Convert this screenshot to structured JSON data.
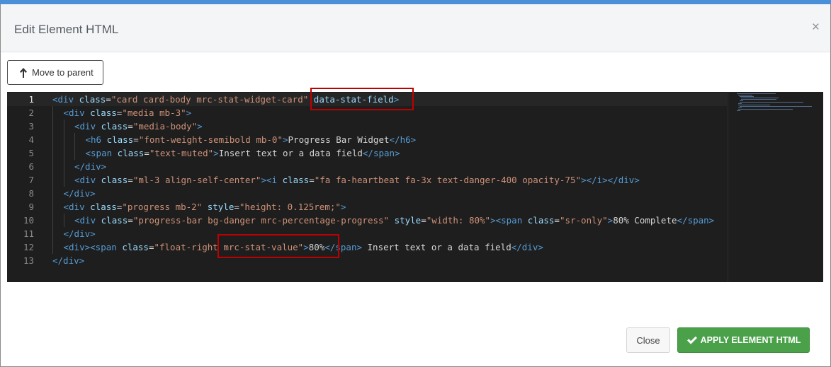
{
  "window": {
    "title": "Edit Element HTML",
    "close_glyph": "×"
  },
  "toolbar": {
    "move_to_parent_label": "Move to parent",
    "move_to_parent_icon": "arrow-up-icon"
  },
  "editor": {
    "language": "html",
    "theme_colors": {
      "background": "#1e1e1e",
      "tag": "#569cd6",
      "attribute": "#9cdcfe",
      "string": "#ce9178",
      "text": "#d4d4d4"
    },
    "active_line": 1,
    "line_numbers": [
      "1",
      "2",
      "3",
      "4",
      "5",
      "6",
      "7",
      "8",
      "9",
      "10",
      "11",
      "12",
      "13"
    ],
    "lines": [
      [
        {
          "t": "tag",
          "v": "<div"
        },
        {
          "t": "txt",
          "v": " "
        },
        {
          "t": "attr",
          "v": "class"
        },
        {
          "t": "txt",
          "v": "="
        },
        {
          "t": "str",
          "v": "\"card card-body mrc-stat-widget-card\""
        },
        {
          "t": "txt",
          "v": " "
        },
        {
          "t": "attr",
          "v": "data-stat-field"
        },
        {
          "t": "tag",
          "v": ">"
        }
      ],
      [
        {
          "t": "tag",
          "v": "<div"
        },
        {
          "t": "txt",
          "v": " "
        },
        {
          "t": "attr",
          "v": "class"
        },
        {
          "t": "txt",
          "v": "="
        },
        {
          "t": "str",
          "v": "\"media mb-3\""
        },
        {
          "t": "tag",
          "v": ">"
        }
      ],
      [
        {
          "t": "tag",
          "v": "<div"
        },
        {
          "t": "txt",
          "v": " "
        },
        {
          "t": "attr",
          "v": "class"
        },
        {
          "t": "txt",
          "v": "="
        },
        {
          "t": "str",
          "v": "\"media-body\""
        },
        {
          "t": "tag",
          "v": ">"
        }
      ],
      [
        {
          "t": "tag",
          "v": "<h6"
        },
        {
          "t": "txt",
          "v": " "
        },
        {
          "t": "attr",
          "v": "class"
        },
        {
          "t": "txt",
          "v": "="
        },
        {
          "t": "str",
          "v": "\"font-weight-semibold mb-0\""
        },
        {
          "t": "tag",
          "v": ">"
        },
        {
          "t": "txt",
          "v": "Progress Bar Widget"
        },
        {
          "t": "tag",
          "v": "</h6>"
        }
      ],
      [
        {
          "t": "tag",
          "v": "<span"
        },
        {
          "t": "txt",
          "v": " "
        },
        {
          "t": "attr",
          "v": "class"
        },
        {
          "t": "txt",
          "v": "="
        },
        {
          "t": "str",
          "v": "\"text-muted\""
        },
        {
          "t": "tag",
          "v": ">"
        },
        {
          "t": "txt",
          "v": "Insert text or a data field"
        },
        {
          "t": "tag",
          "v": "</span>"
        }
      ],
      [
        {
          "t": "tag",
          "v": "</div>"
        }
      ],
      [
        {
          "t": "tag",
          "v": "<div"
        },
        {
          "t": "txt",
          "v": " "
        },
        {
          "t": "attr",
          "v": "class"
        },
        {
          "t": "txt",
          "v": "="
        },
        {
          "t": "str",
          "v": "\"ml-3 align-self-center\""
        },
        {
          "t": "tag",
          "v": ">"
        },
        {
          "t": "tag",
          "v": "<i"
        },
        {
          "t": "txt",
          "v": " "
        },
        {
          "t": "attr",
          "v": "class"
        },
        {
          "t": "txt",
          "v": "="
        },
        {
          "t": "str",
          "v": "\"fa fa-heartbeat fa-3x text-danger-400 opacity-75\""
        },
        {
          "t": "tag",
          "v": ">"
        },
        {
          "t": "tag",
          "v": "</i>"
        },
        {
          "t": "tag",
          "v": "</div>"
        }
      ],
      [
        {
          "t": "tag",
          "v": "</div>"
        }
      ],
      [
        {
          "t": "tag",
          "v": "<div"
        },
        {
          "t": "txt",
          "v": " "
        },
        {
          "t": "attr",
          "v": "class"
        },
        {
          "t": "txt",
          "v": "="
        },
        {
          "t": "str",
          "v": "\"progress mb-2\""
        },
        {
          "t": "txt",
          "v": " "
        },
        {
          "t": "attr",
          "v": "style"
        },
        {
          "t": "txt",
          "v": "="
        },
        {
          "t": "str",
          "v": "\"height: 0.125rem;\""
        },
        {
          "t": "tag",
          "v": ">"
        }
      ],
      [
        {
          "t": "tag",
          "v": "<div"
        },
        {
          "t": "txt",
          "v": " "
        },
        {
          "t": "attr",
          "v": "class"
        },
        {
          "t": "txt",
          "v": "="
        },
        {
          "t": "str",
          "v": "\"progress-bar bg-danger mrc-percentage-progress\""
        },
        {
          "t": "txt",
          "v": " "
        },
        {
          "t": "attr",
          "v": "style"
        },
        {
          "t": "txt",
          "v": "="
        },
        {
          "t": "str",
          "v": "\"width: 80%\""
        },
        {
          "t": "tag",
          "v": ">"
        },
        {
          "t": "tag",
          "v": "<span"
        },
        {
          "t": "txt",
          "v": " "
        },
        {
          "t": "attr",
          "v": "class"
        },
        {
          "t": "txt",
          "v": "="
        },
        {
          "t": "str",
          "v": "\"sr-only\""
        },
        {
          "t": "tag",
          "v": ">"
        },
        {
          "t": "txt",
          "v": "80% Complete"
        },
        {
          "t": "tag",
          "v": "</span>"
        }
      ],
      [
        {
          "t": "tag",
          "v": "</div>"
        }
      ],
      [
        {
          "t": "tag",
          "v": "<div>"
        },
        {
          "t": "tag",
          "v": "<span"
        },
        {
          "t": "txt",
          "v": " "
        },
        {
          "t": "attr",
          "v": "class"
        },
        {
          "t": "txt",
          "v": "="
        },
        {
          "t": "str",
          "v": "\"float-right mrc-stat-value\""
        },
        {
          "t": "tag",
          "v": ">"
        },
        {
          "t": "txt",
          "v": "80%"
        },
        {
          "t": "tag",
          "v": "</span>"
        },
        {
          "t": "txt",
          "v": " Insert text or a data field"
        },
        {
          "t": "tag",
          "v": "</div>"
        }
      ],
      [
        {
          "t": "tag",
          "v": "</div>"
        }
      ]
    ],
    "indent_levels": [
      0,
      1,
      2,
      3,
      3,
      2,
      2,
      1,
      1,
      2,
      1,
      1,
      0
    ]
  },
  "footer": {
    "close_label": "Close",
    "apply_label": "APPLY ELEMENT HTML",
    "apply_icon": "check-icon",
    "apply_color": "#4aa14a"
  }
}
